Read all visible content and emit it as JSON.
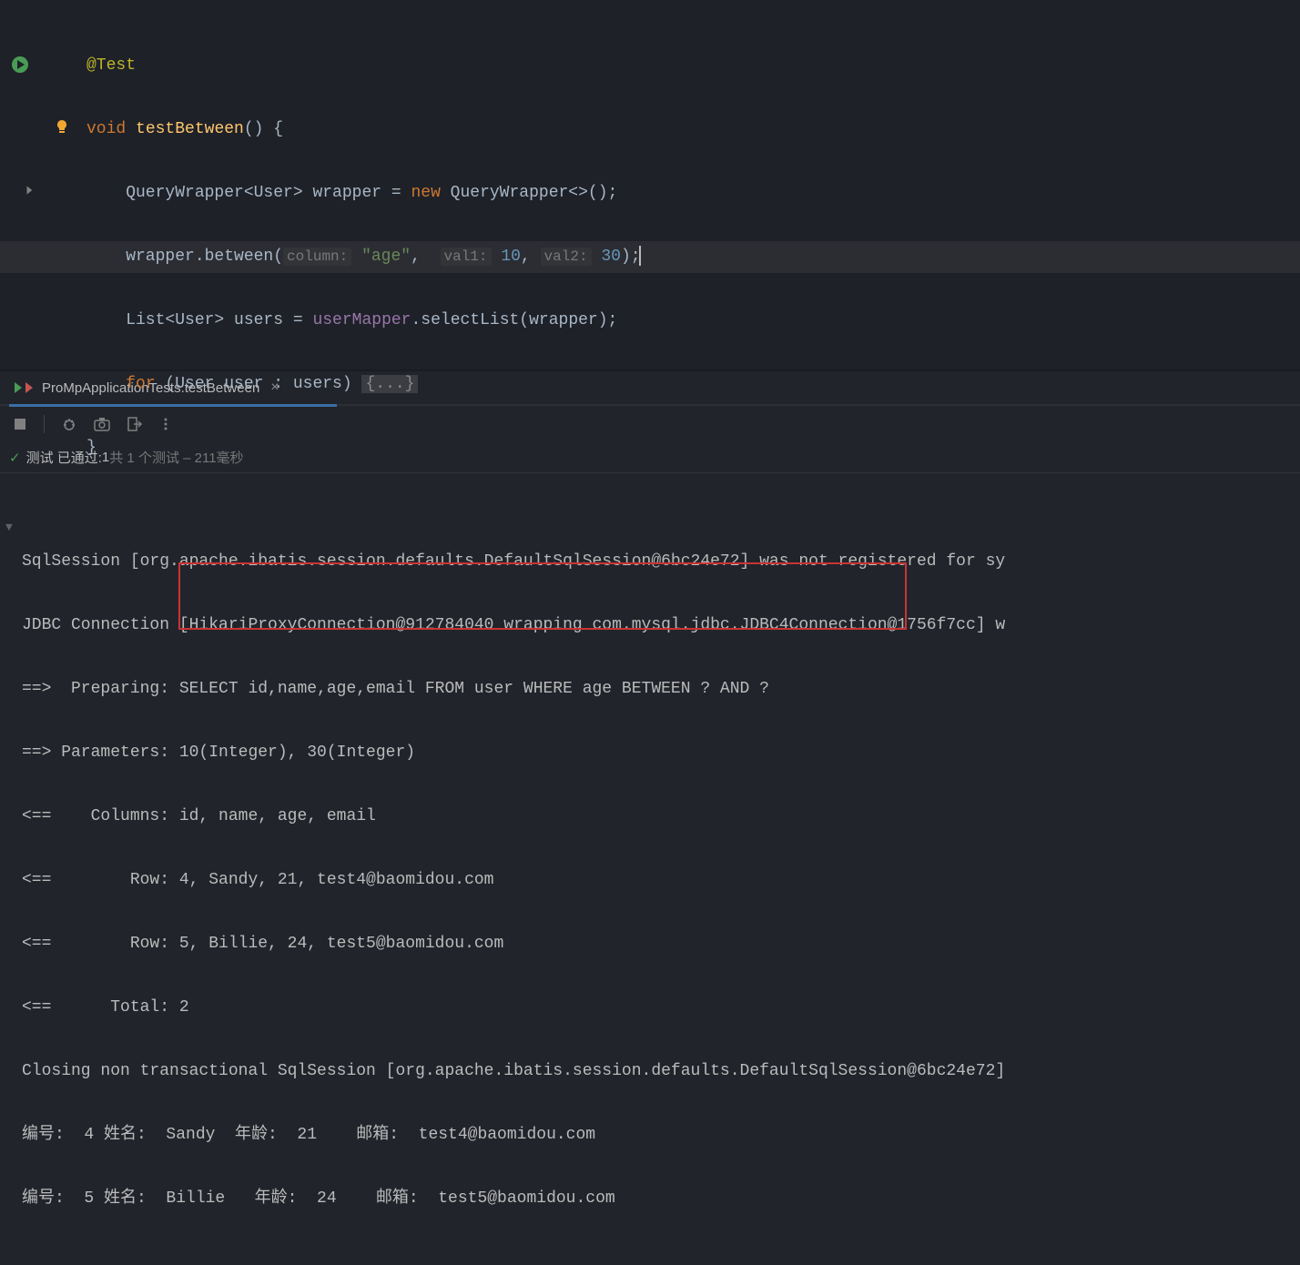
{
  "code": {
    "annotation": "@Test",
    "keyword_void": "void",
    "method_name": "testBetween",
    "sig_paren": "() {",
    "line2_pre": "    QueryWrapper<User> wrapper = ",
    "line2_new": "new",
    "line2_post": " QueryWrapper<>();",
    "line3_pre": "    wrapper.between(",
    "line3_hint1": "column:",
    "line3_str": " \"age\"",
    "line3_comma1": ", ",
    "line3_hint2": "val1:",
    "line3_num1": " 10",
    "line3_comma2": ", ",
    "line3_hint3": "val2:",
    "line3_num2": " 30",
    "line3_end": ");",
    "line4_pre": "    List<User> users = ",
    "line4_field": "userMapper",
    "line4_post": ".selectList(wrapper);",
    "line5_pre": "    ",
    "line5_for": "for",
    "line5_mid": " (User user : users) ",
    "line5_fold": "{...}",
    "line6": "}",
    "line7": "}"
  },
  "tab": {
    "name": "ProMpApplicationTests.testBetween",
    "close": "×"
  },
  "test_status": {
    "check": "✓",
    "label1": "测试 已通过:",
    "count": " 1",
    "label2": "共 1 个测试 – 211毫秒"
  },
  "console": {
    "l1": "SqlSession [org.apache.ibatis.session.defaults.DefaultSqlSession@6bc24e72] was not registered for sy",
    "l2": "JDBC Connection [HikariProxyConnection@912784040 wrapping com.mysql.jdbc.JDBC4Connection@1756f7cc] w",
    "l3": "==>  Preparing: SELECT id,name,age,email FROM user WHERE age BETWEEN ? AND ? ",
    "l4": "==> Parameters: 10(Integer), 30(Integer)",
    "l5": "<==    Columns: id, name, age, email",
    "l6": "<==        Row: 4, Sandy, 21, test4@baomidou.com",
    "l7": "<==        Row: 5, Billie, 24, test5@baomidou.com",
    "l8": "<==      Total: 2",
    "l9": "Closing non transactional SqlSession [org.apache.ibatis.session.defaults.DefaultSqlSession@6bc24e72]",
    "l10": "编号:  4 姓名:  Sandy  年龄:  21    邮箱:  test4@baomidou.com",
    "l11": "编号:  5 姓名:  Billie   年龄:  24    邮箱:  test5@baomidou.com"
  }
}
